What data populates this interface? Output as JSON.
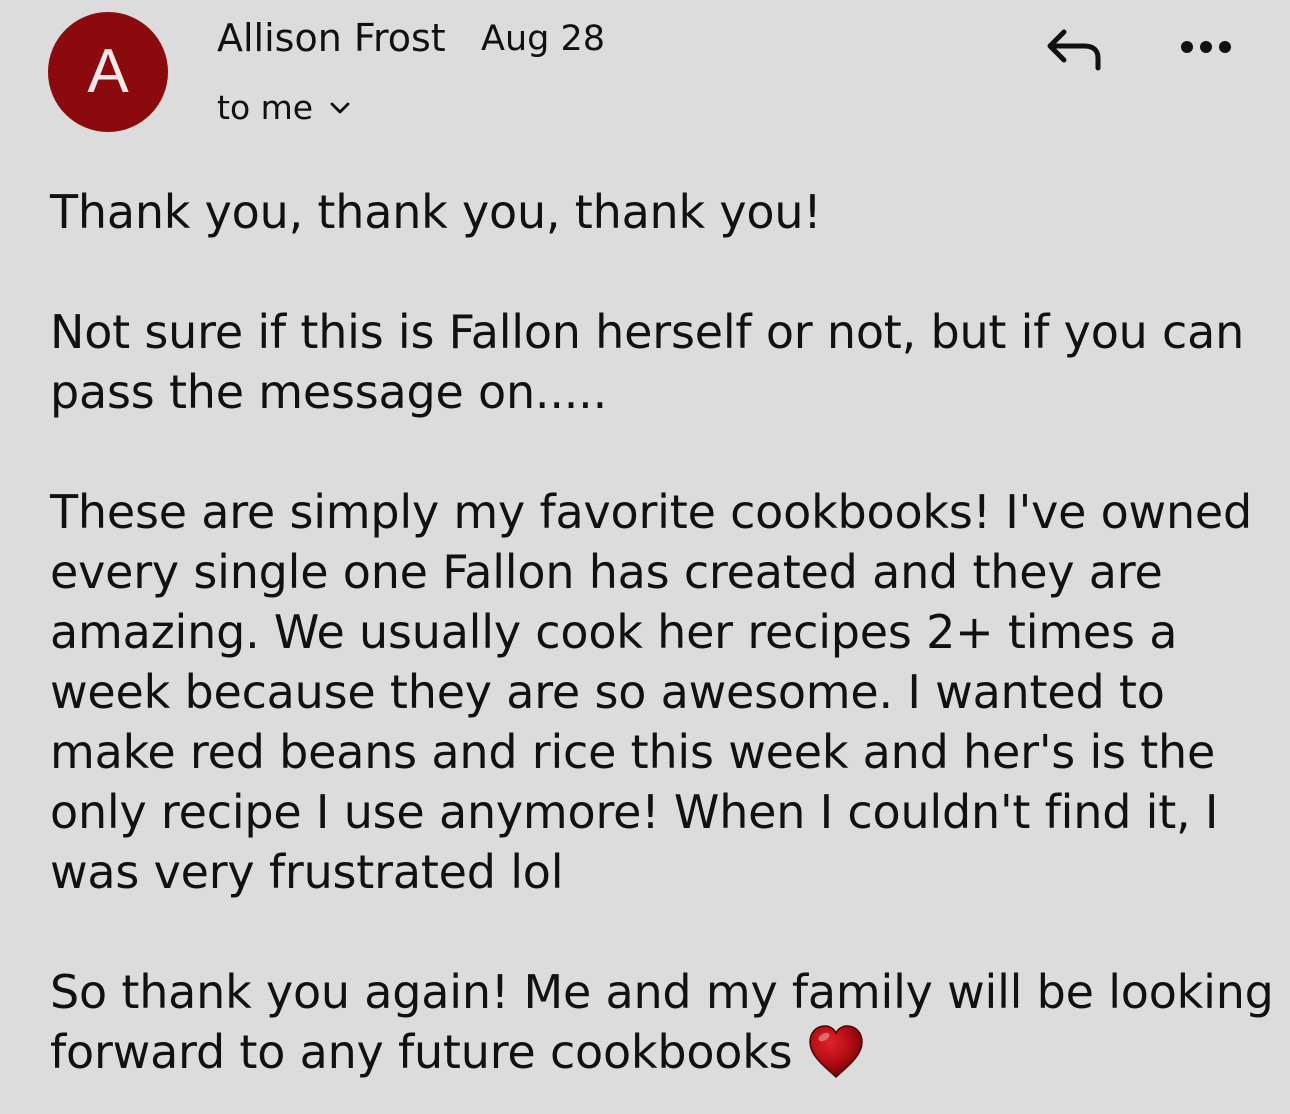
{
  "email": {
    "avatar_letter": "A",
    "avatar_color": "#8b0a0d",
    "sender_name": "Allison Frost",
    "date": "Aug 28",
    "recipient_label": "to me",
    "recipient_toggle_icon": "chevron-down-icon",
    "reply_icon": "reply-icon",
    "more_icon": "more-options-icon",
    "body": {
      "paragraph_1": [
        "Thank you, thank you, thank you!"
      ],
      "paragraph_2": [
        "Not sure if this is Fallon herself or not, but if you can",
        "pass the message on....."
      ],
      "paragraph_3": [
        "These are simply my favorite cookbooks! I've owned",
        "every single one Fallon has created and they are",
        "amazing. We usually cook her recipes 2+ times a",
        "week because they are so awesome. I wanted to",
        "make red beans and rice this week and her's is the",
        "only recipe I use anymore! When I couldn't find it, I",
        "was very frustrated lol"
      ],
      "paragraph_4": [
        "So thank you again! Me and my family will be looking",
        "forward to any future cookbooks"
      ],
      "closing_emoji": "heart-emoji"
    }
  }
}
